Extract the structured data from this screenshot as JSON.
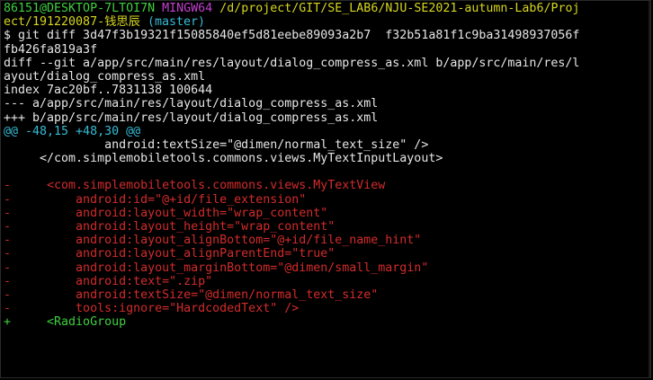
{
  "colors": {
    "prompt_user": "#3fcf3f",
    "prompt_shell": "#c33fcf",
    "prompt_path": "#d6d61f",
    "branch": "#35bcd6",
    "text": "#e6e6e6",
    "removed": "#d22b2b",
    "added": "#3fcf3f",
    "hunk": "#35bcd6",
    "background": "#000000"
  },
  "prompt": {
    "user_host": "86151@DESKTOP-7LTOI7N",
    "shell": "MINGW64",
    "path_line1": "/d/project/GIT/SE_LAB6/NJU-SE2021-autumn-Lab6/Proj",
    "path_line2": "ect/191220087-钱思辰",
    "branch": "(master)"
  },
  "command": {
    "line1": "$ git diff 3d47f3b19321f15085840ef5d81eebe89093a2b7  f32b51a81f1c9ba31498937056f",
    "line2": "fb426fa819a3f"
  },
  "diff_header": {
    "git_line1": "diff --git a/app/src/main/res/layout/dialog_compress_as.xml b/app/src/main/res/l",
    "git_line2": "ayout/dialog_compress_as.xml",
    "index": "index 7ac20bf..7831138 100644",
    "old_file": "--- a/app/src/main/res/layout/dialog_compress_as.xml",
    "new_file": "+++ b/app/src/main/res/layout/dialog_compress_as.xml",
    "hunk": "@@ -48,15 +48,30 @@"
  },
  "context_lines": [
    "              android:textSize=\"@dimen/normal_text_size\" />",
    "     </com.simplemobiletools.commons.views.MyTextInputLayout>",
    ""
  ],
  "removed_lines": [
    "-     <com.simplemobiletools.commons.views.MyTextView",
    "-         android:id=\"@+id/file_extension\"",
    "-         android:layout_width=\"wrap_content\"",
    "-         android:layout_height=\"wrap_content\"",
    "-         android:layout_alignBottom=\"@+id/file_name_hint\"",
    "-         android:layout_alignParentEnd=\"true\"",
    "-         android:layout_marginBottom=\"@dimen/small_margin\"",
    "-         android:text=\".zip\"",
    "-         android:textSize=\"@dimen/normal_text_size\"",
    "-         tools:ignore=\"HardcodedText\" />"
  ],
  "added_lines": [
    "+     <RadioGroup"
  ]
}
